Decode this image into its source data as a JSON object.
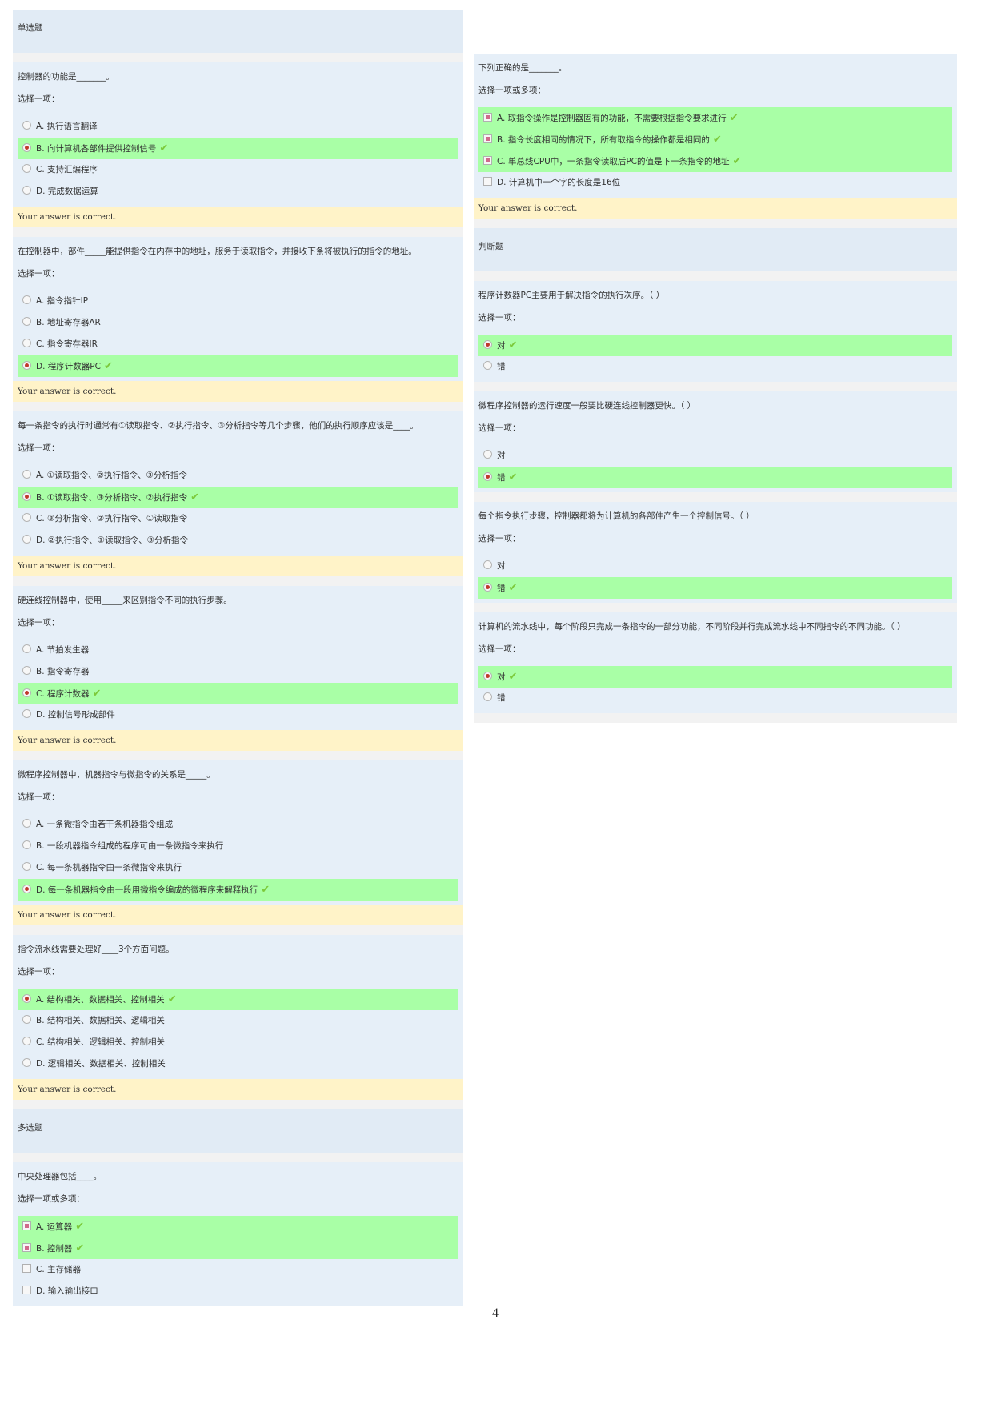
{
  "feedback": "Your answer is correct.",
  "left": {
    "section_single": "单选题",
    "section_multi": "多选题",
    "questions": [
      {
        "text": "控制器的功能是_______。",
        "prompt": "选择一项：",
        "options": [
          "A. 执行语言翻译",
          "B. 向计算机各部件提供控制信号",
          "C. 支持汇编程序",
          "D. 完成数据运算"
        ],
        "selected": 1
      },
      {
        "text": "在控制器中，部件_____能提供指令在内存中的地址，服务于读取指令，并接收下条将被执行的指令的地址。",
        "prompt": "选择一项：",
        "options": [
          "A. 指令指针IP",
          "B. 地址寄存器AR",
          "C. 指令寄存器IR",
          "D. 程序计数器PC"
        ],
        "selected": 3
      },
      {
        "text": "每一条指令的执行时通常有①读取指令、②执行指令、③分析指令等几个步骤，他们的执行顺序应该是____。",
        "prompt": "选择一项：",
        "options": [
          "A. ①读取指令、②执行指令、③分析指令",
          "B. ①读取指令、③分析指令、②执行指令",
          "C. ③分析指令、②执行指令、①读取指令",
          "D. ②执行指令、①读取指令、③分析指令"
        ],
        "selected": 1
      },
      {
        "text": "硬连线控制器中，使用_____来区别指令不同的执行步骤。",
        "prompt": "选择一项：",
        "options": [
          "A. 节拍发生器",
          "B. 指令寄存器",
          "C. 程序计数器",
          "D. 控制信号形成部件"
        ],
        "selected": 2
      },
      {
        "text": "微程序控制器中，机器指令与微指令的关系是_____。",
        "prompt": "选择一项：",
        "options": [
          "A. 一条微指令由若干条机器指令组成",
          "B. 一段机器指令组成的程序可由一条微指令来执行",
          "C. 每一条机器指令由一条微指令来执行",
          "D. 每一条机器指令由一段用微指令编成的微程序来解释执行"
        ],
        "selected": 3
      },
      {
        "text": "指令流水线需要处理好____3个方面问题。",
        "prompt": "选择一项：",
        "options": [
          "A. 结构相关、数据相关、控制相关",
          "B. 结构相关、数据相关、逻辑相关",
          "C. 结构相关、逻辑相关、控制相关",
          "D. 逻辑相关、数据相关、控制相关"
        ],
        "selected": 0
      }
    ],
    "multi_question": {
      "text": "中央处理器包括____。",
      "prompt": "选择一项或多项：",
      "options": [
        "A. 运算器",
        "B. 控制器",
        "C. 主存储器",
        "D. 输入输出接口"
      ],
      "selected": [
        0,
        1
      ]
    }
  },
  "right": {
    "multi_question": {
      "text": "下列正确的是_______。",
      "prompt": "选择一项或多项：",
      "options": [
        "A. 取指令操作是控制器固有的功能，不需要根据指令要求进行",
        "B. 指令长度相同的情况下，所有取指令的操作都是相同的",
        "C. 单总线CPU中，一条指令读取后PC的值是下一条指令的地址",
        "D. 计算机中一个字的长度是16位"
      ],
      "selected": [
        0,
        1,
        2
      ]
    },
    "section_judge": "判断题",
    "judge_questions": [
      {
        "text": "程序计数器PC主要用于解决指令的执行次序。（ ）",
        "prompt": "选择一项：",
        "options": [
          "对",
          "错"
        ],
        "selected": 0
      },
      {
        "text": "微程序控制器的运行速度一般要比硬连线控制器更快。（ ）",
        "prompt": "选择一项：",
        "options": [
          "对",
          "错"
        ],
        "selected": 1
      },
      {
        "text": "每个指令执行步骤，控制器都将为计算机的各部件产生一个控制信号。（ ）",
        "prompt": "选择一项：",
        "options": [
          "对",
          "错"
        ],
        "selected": 1
      },
      {
        "text": "计算机的流水线中，每个阶段只完成一条指令的一部分功能，不同阶段并行完成流水线中不同指令的不同功能。（ ）",
        "prompt": "选择一项：",
        "options": [
          "对",
          "错"
        ],
        "selected": 0
      }
    ]
  },
  "page_number": "4",
  "colors": {
    "question_bg": "#e6eff8",
    "selected_bg": "#a9ffa6",
    "feedback_bg": "#fff3c8",
    "check_mark": "#7cc93a"
  }
}
